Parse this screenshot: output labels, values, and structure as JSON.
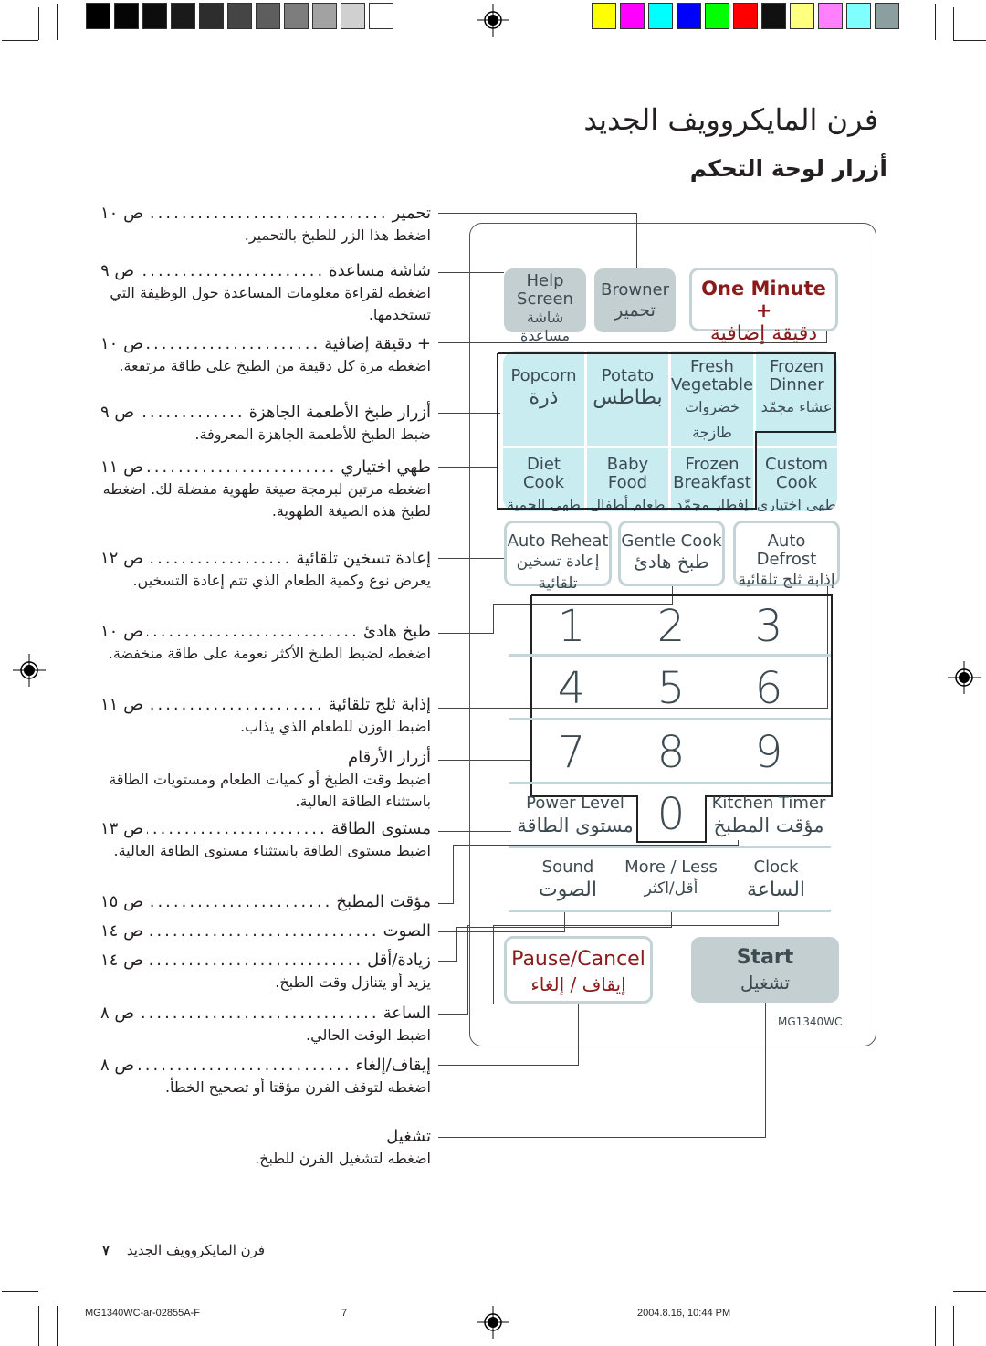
{
  "print_marks": {
    "gray_swatches": [
      "#000000",
      "#050505",
      "#0d0d0d",
      "#1a1a1a",
      "#2d2d2d",
      "#454545",
      "#5e5e5e",
      "#7d7d7d",
      "#a2a2a2",
      "#d0d0d0",
      "#ffffff"
    ],
    "color_swatches": [
      "#ffff00",
      "#ff00ff",
      "#00ffff",
      "#0000ff",
      "#00ff00",
      "#ff0000",
      "#111111",
      "#ffff80",
      "#ff80ff",
      "#80ffff",
      "#8c9fa0"
    ]
  },
  "page": {
    "title": "فرن المايكروويف الجديد",
    "subtitle": "أزرار لوحة التحكم"
  },
  "descriptions": [
    {
      "name": "تحمير",
      "page": "ص ١٠",
      "body": "اضغط هذا الزر للطبخ بالتحمير."
    },
    {
      "name": "شاشة مساعدة",
      "page": "ص ٩",
      "body": "اضغطه لقراءة معلومات المساعدة حول الوظيفة التي تستخدمها."
    },
    {
      "name": "+ دقيقة إضافية",
      "page": "ص ١٠",
      "body": "اضغطه مرة كل دقيقة من الطبخ على طاقة مرتفعة."
    },
    {
      "name": "أزرار طبخ الأطعمة الجاهزة",
      "page": "ص ٩",
      "body": "ضبط الطبخ للأطعمة الجاهزة المعروفة."
    },
    {
      "name": "طهي اختياري",
      "page": "ص ١١",
      "body": "اضغطه مرتين لبرمجة صيغة طهوية مفضلة لك. اضغطه لطبخ هذه الصيغة الطهوية."
    },
    {
      "name": "إعادة تسخين تلقائية",
      "page": "ص ١٢",
      "body": "يعرض نوع وكمية الطعام الذي تتم إعادة التسخين."
    },
    {
      "name": "طبخ هادئ",
      "page": "ص ١٠",
      "body": "اضغطه لضبط الطبخ الأكثر نعومة على طاقة منخفضة."
    },
    {
      "name": "إذابة ثلج تلقائية",
      "page": "ص ١١",
      "body": "اضبط الوزن للطعام الذي يذاب."
    },
    {
      "name": "أزرار الأرقام",
      "page": "",
      "body": "اضبط وقت الطبخ أو كميات الطعام ومستويات الطاقة باستثناء الطاقة العالية."
    },
    {
      "name": "مستوى الطاقة",
      "page": "ص ١٣",
      "body": "اضبط مستوى الطاقة باستثناء مستوى الطاقة العالية."
    },
    {
      "name": "مؤقت المطبخ",
      "page": "ص ١٥",
      "body": ""
    },
    {
      "name": "الصوت",
      "page": "ص ١٤",
      "body": ""
    },
    {
      "name": "زيادة/أقل",
      "page": "ص ١٤",
      "body": "يزيد أو يتنازل وقت الطبخ."
    },
    {
      "name": "الساعة",
      "page": "ص ٨",
      "body": "اضبط الوقت الحالي."
    },
    {
      "name": "إيقاف/إلغاء",
      "page": "ص ٨",
      "body": "اضغطه لتوقف الفرن مؤقتا أو تصحيح الخطأ."
    },
    {
      "name": "تشغيل",
      "page": "",
      "body": "اضغطه لتشغيل الفرن للطبخ."
    }
  ],
  "panel": {
    "top_keys": {
      "help": {
        "en1": "Help",
        "en2": "Screen",
        "ar": "شاشة مساعدة"
      },
      "browner": {
        "en": "Browner",
        "ar": "تحمير"
      },
      "one_minute": {
        "en": "One Minute +",
        "ar": "دقيقة إضافية"
      }
    },
    "food_keys": [
      {
        "en1": "Popcorn",
        "en2": "",
        "ar": "ذرة"
      },
      {
        "en1": "Potato",
        "en2": "",
        "ar": "بطاطس"
      },
      {
        "en1": "Fresh",
        "en2": "Vegetable",
        "ar": "خضروات طازجة"
      },
      {
        "en1": "Frozen",
        "en2": "Dinner",
        "ar": "عشاء مجمّد"
      },
      {
        "en1": "Diet",
        "en2": "Cook",
        "ar": "طهي الحمية"
      },
      {
        "en1": "Baby",
        "en2": "Food",
        "ar": "طعام أطفال"
      },
      {
        "en1": "Frozen",
        "en2": "Breakfast",
        "ar": "إفطار مجمّد"
      },
      {
        "en1": "Custom",
        "en2": "Cook",
        "ar": "طهي اختياري"
      }
    ],
    "auto_keys": [
      {
        "en": "Auto Reheat",
        "ar": "إعادة تسخين تلقائية"
      },
      {
        "en": "Gentle Cook",
        "ar": "طبخ هادئ"
      },
      {
        "en": "Auto Defrost",
        "ar": "إذابة ثلج تلقائية"
      }
    ],
    "digits": [
      "1",
      "2",
      "3",
      "4",
      "5",
      "6",
      "7",
      "8",
      "9",
      "0"
    ],
    "power_level": {
      "en": "Power Level",
      "ar": "مستوى الطاقة"
    },
    "kitchen_timer": {
      "en": "Kitchen Timer",
      "ar": "مؤقت المطبخ"
    },
    "sound": {
      "en": "Sound",
      "ar": "الصوت"
    },
    "more_less": {
      "en": "More / Less",
      "ar": "أقل/اكثر"
    },
    "clock": {
      "en": "Clock",
      "ar": "الساعة"
    },
    "pause_cancel": {
      "en": "Pause/Cancel",
      "ar": "إيقاف / إلغاء"
    },
    "start": {
      "en": "Start",
      "ar": "تشغيل"
    },
    "model": "MG1340WC"
  },
  "footer": {
    "page_label": "فرن المايكروويف الجديد",
    "page_number": "٧",
    "file_name": "MG1340WC-ar-02855A-F",
    "sheet": "7",
    "timestamp": "2004.8.16, 10:44 PM"
  },
  "colors": {
    "accent_red": "#8b1a1a",
    "key_grey": "#c3cfd1",
    "key_cyan": "#c8ecf0",
    "key_text": "#3d4a52"
  }
}
